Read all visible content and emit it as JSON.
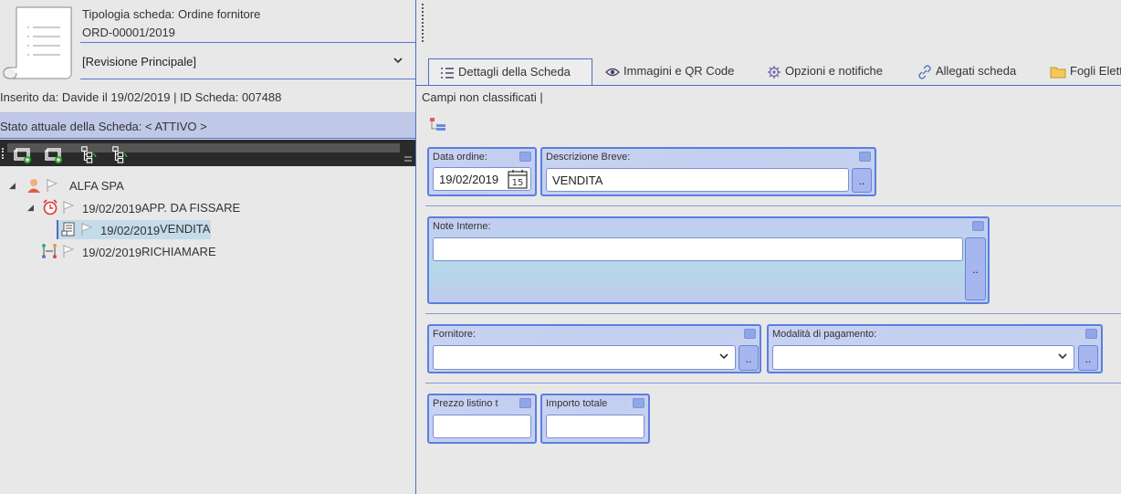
{
  "header": {
    "card_type": "Tipologia scheda: Ordine fornitore",
    "card_code": "ORD-00001/2019",
    "revision": "[Revisione Principale]"
  },
  "info": {
    "inserted": "Inserito da: Davide il 19/02/2019 |  ID Scheda: 007488",
    "status": "Stato attuale della Scheda:  < ATTIVO >"
  },
  "tree": [
    {
      "date": "",
      "label": "ALFA SPA"
    },
    {
      "date": "19/02/2019",
      "label": "APP. DA FISSARE"
    },
    {
      "date": "19/02/2019",
      "label": "VENDITA"
    },
    {
      "date": "19/02/2019",
      "label": "RICHIAMARE"
    }
  ],
  "tabs": [
    {
      "label": "Dettagli della Scheda",
      "icon": "list-icon"
    },
    {
      "label": "Immagini e QR Code",
      "icon": "eye-icon"
    },
    {
      "label": "Opzioni e notifiche",
      "icon": "gear-icon"
    },
    {
      "label": "Allegati scheda",
      "icon": "link-icon"
    },
    {
      "label": "Fogli Elett",
      "icon": "folder-icon"
    }
  ],
  "breadcrumb": "Campi non classificati  |",
  "form": {
    "data_ordine": {
      "label": "Data ordine:",
      "value": "19/02/2019"
    },
    "descrizione_breve": {
      "label": "Descrizione Breve:",
      "value": "VENDITA"
    },
    "note_interne": {
      "label": "Note Interne:",
      "value": ""
    },
    "fornitore": {
      "label": "Fornitore:",
      "value": ""
    },
    "modalita_pagamento": {
      "label": "Modalità di pagamento:",
      "value": ""
    },
    "prezzo_listino": {
      "label": "Prezzo listino t",
      "value": ""
    },
    "importo_totale": {
      "label": "Importo totale",
      "value": ""
    }
  },
  "buttons": {
    "dots": ".."
  },
  "calendar_day": "15",
  "colors": {
    "accent": "#4a6fc6",
    "status_bg": "#c0c8e8",
    "field_bg": "#c8d2f2"
  }
}
